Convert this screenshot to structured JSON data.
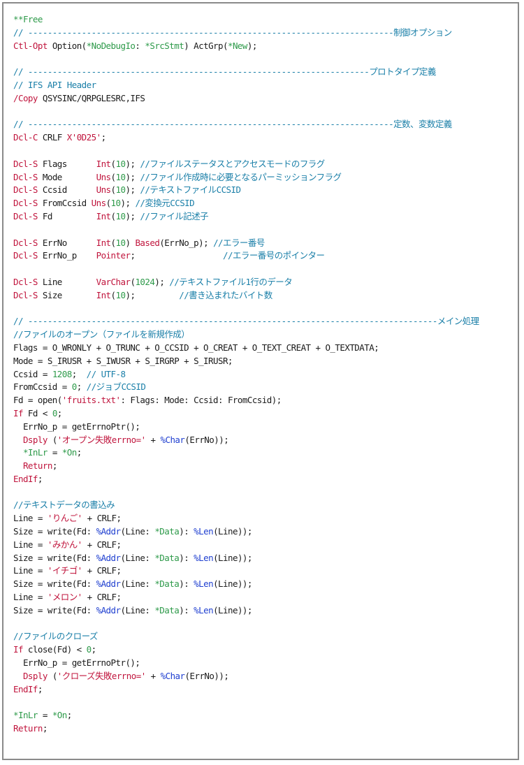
{
  "colors": {
    "plain": "#1a1a1a",
    "comment": "#1a7fa8",
    "keyword": "#c0143c",
    "string": "#c0143c",
    "number": "#2e9a4a",
    "special": "#2e9a4a",
    "builtin": "#1f3fd0",
    "border": "#8a8a8a"
  },
  "lines": [
    [
      [
        "spec",
        "**Free"
      ]
    ],
    [
      [
        "cmt",
        "// ---------------------------------------------------------------------------制御オプション"
      ]
    ],
    [
      [
        "kw",
        "Ctl-Opt"
      ],
      [
        "plain",
        " Option("
      ],
      [
        "spec",
        "*NoDebugIo"
      ],
      [
        "plain",
        ": "
      ],
      [
        "spec",
        "*SrcStmt"
      ],
      [
        "plain",
        ") ActGrp("
      ],
      [
        "spec",
        "*New"
      ],
      [
        "plain",
        ");"
      ]
    ],
    [],
    [
      [
        "cmt",
        "// ----------------------------------------------------------------------プロトタイプ定義"
      ]
    ],
    [
      [
        "cmt",
        "// IFS API Header"
      ]
    ],
    [
      [
        "kw",
        "/Copy"
      ],
      [
        "plain",
        " QSYSINC/QRPGLESRC,IFS"
      ]
    ],
    [],
    [
      [
        "cmt",
        "// ---------------------------------------------------------------------------定数、変数定義"
      ]
    ],
    [
      [
        "kw",
        "Dcl-C"
      ],
      [
        "plain",
        " CRLF "
      ],
      [
        "str",
        "X'0D25'"
      ],
      [
        "plain",
        ";"
      ]
    ],
    [],
    [
      [
        "kw",
        "Dcl-S"
      ],
      [
        "plain",
        " Flags      "
      ],
      [
        "kw",
        "Int"
      ],
      [
        "plain",
        "("
      ],
      [
        "num",
        "10"
      ],
      [
        "plain",
        "); "
      ],
      [
        "cmt",
        "//ファイルステータスとアクセスモードのフラグ"
      ]
    ],
    [
      [
        "kw",
        "Dcl-S"
      ],
      [
        "plain",
        " Mode       "
      ],
      [
        "kw",
        "Uns"
      ],
      [
        "plain",
        "("
      ],
      [
        "num",
        "10"
      ],
      [
        "plain",
        "); "
      ],
      [
        "cmt",
        "//ファイル作成時に必要となるパーミッションフラグ"
      ]
    ],
    [
      [
        "kw",
        "Dcl-S"
      ],
      [
        "plain",
        " Ccsid      "
      ],
      [
        "kw",
        "Uns"
      ],
      [
        "plain",
        "("
      ],
      [
        "num",
        "10"
      ],
      [
        "plain",
        "); "
      ],
      [
        "cmt",
        "//テキストファイルCCSID"
      ]
    ],
    [
      [
        "kw",
        "Dcl-S"
      ],
      [
        "plain",
        " FromCcsid "
      ],
      [
        "kw",
        "Uns"
      ],
      [
        "plain",
        "("
      ],
      [
        "num",
        "10"
      ],
      [
        "plain",
        "); "
      ],
      [
        "cmt",
        "//変換元CCSID"
      ]
    ],
    [
      [
        "kw",
        "Dcl-S"
      ],
      [
        "plain",
        " Fd         "
      ],
      [
        "kw",
        "Int"
      ],
      [
        "plain",
        "("
      ],
      [
        "num",
        "10"
      ],
      [
        "plain",
        "); "
      ],
      [
        "cmt",
        "//ファイル記述子"
      ]
    ],
    [],
    [
      [
        "kw",
        "Dcl-S"
      ],
      [
        "plain",
        " ErrNo      "
      ],
      [
        "kw",
        "Int"
      ],
      [
        "plain",
        "("
      ],
      [
        "num",
        "10"
      ],
      [
        "plain",
        ") "
      ],
      [
        "kw",
        "Based"
      ],
      [
        "plain",
        "(ErrNo_p); "
      ],
      [
        "cmt",
        "//エラー番号"
      ]
    ],
    [
      [
        "kw",
        "Dcl-S"
      ],
      [
        "plain",
        " ErrNo_p    "
      ],
      [
        "kw",
        "Pointer"
      ],
      [
        "plain",
        ";                  "
      ],
      [
        "cmt",
        "//エラー番号のポインター"
      ]
    ],
    [],
    [
      [
        "kw",
        "Dcl-S"
      ],
      [
        "plain",
        " Line       "
      ],
      [
        "kw",
        "VarChar"
      ],
      [
        "plain",
        "("
      ],
      [
        "num",
        "1024"
      ],
      [
        "plain",
        "); "
      ],
      [
        "cmt",
        "//テキストファイル1行のデータ"
      ]
    ],
    [
      [
        "kw",
        "Dcl-S"
      ],
      [
        "plain",
        " Size       "
      ],
      [
        "kw",
        "Int"
      ],
      [
        "plain",
        "("
      ],
      [
        "num",
        "10"
      ],
      [
        "plain",
        ");         "
      ],
      [
        "cmt",
        "//書き込まれたバイト数"
      ]
    ],
    [],
    [
      [
        "cmt",
        "// ------------------------------------------------------------------------------------メイン処理"
      ]
    ],
    [
      [
        "cmt",
        "//ファイルのオープン（ファイルを新規作成）"
      ]
    ],
    [
      [
        "plain",
        "Flags = O_WRONLY + O_TRUNC + O_CCSID + O_CREAT + O_TEXT_CREAT + O_TEXTDATA;"
      ]
    ],
    [
      [
        "plain",
        "Mode = S_IRUSR + S_IWUSR + S_IRGRP + S_IRUSR;"
      ]
    ],
    [
      [
        "plain",
        "Ccsid = "
      ],
      [
        "num",
        "1208"
      ],
      [
        "plain",
        ";  "
      ],
      [
        "cmt",
        "// UTF-8"
      ]
    ],
    [
      [
        "plain",
        "FromCcsid = "
      ],
      [
        "num",
        "0"
      ],
      [
        "plain",
        "; "
      ],
      [
        "cmt",
        "//ジョブCCSID"
      ]
    ],
    [
      [
        "plain",
        "Fd = open("
      ],
      [
        "str",
        "'fruits.txt'"
      ],
      [
        "plain",
        ": Flags: Mode: Ccsid: FromCcsid);"
      ]
    ],
    [
      [
        "kw",
        "If"
      ],
      [
        "plain",
        " Fd < "
      ],
      [
        "num",
        "0"
      ],
      [
        "plain",
        ";"
      ]
    ],
    [
      [
        "plain",
        "  ErrNo_p = getErrnoPtr();"
      ]
    ],
    [
      [
        "plain",
        "  "
      ],
      [
        "kw",
        "Dsply"
      ],
      [
        "plain",
        " ("
      ],
      [
        "str",
        "'オープン失敗errno='"
      ],
      [
        "plain",
        " + "
      ],
      [
        "bif",
        "%Char"
      ],
      [
        "plain",
        "(ErrNo));"
      ]
    ],
    [
      [
        "plain",
        "  "
      ],
      [
        "spec",
        "*InLr"
      ],
      [
        "plain",
        " = "
      ],
      [
        "spec",
        "*On"
      ],
      [
        "plain",
        ";"
      ]
    ],
    [
      [
        "plain",
        "  "
      ],
      [
        "kw",
        "Return"
      ],
      [
        "plain",
        ";"
      ]
    ],
    [
      [
        "kw",
        "EndIf"
      ],
      [
        "plain",
        ";"
      ]
    ],
    [],
    [
      [
        "cmt",
        "//テキストデータの書込み"
      ]
    ],
    [
      [
        "plain",
        "Line = "
      ],
      [
        "str",
        "'りんご'"
      ],
      [
        "plain",
        " + CRLF;"
      ]
    ],
    [
      [
        "plain",
        "Size = write(Fd: "
      ],
      [
        "bif",
        "%Addr"
      ],
      [
        "plain",
        "(Line: "
      ],
      [
        "spec",
        "*Data"
      ],
      [
        "plain",
        "): "
      ],
      [
        "bif",
        "%Len"
      ],
      [
        "plain",
        "(Line));"
      ]
    ],
    [
      [
        "plain",
        "Line = "
      ],
      [
        "str",
        "'みかん'"
      ],
      [
        "plain",
        " + CRLF;"
      ]
    ],
    [
      [
        "plain",
        "Size = write(Fd: "
      ],
      [
        "bif",
        "%Addr"
      ],
      [
        "plain",
        "(Line: "
      ],
      [
        "spec",
        "*Data"
      ],
      [
        "plain",
        "): "
      ],
      [
        "bif",
        "%Len"
      ],
      [
        "plain",
        "(Line));"
      ]
    ],
    [
      [
        "plain",
        "Line = "
      ],
      [
        "str",
        "'イチゴ'"
      ],
      [
        "plain",
        " + CRLF;"
      ]
    ],
    [
      [
        "plain",
        "Size = write(Fd: "
      ],
      [
        "bif",
        "%Addr"
      ],
      [
        "plain",
        "(Line: "
      ],
      [
        "spec",
        "*Data"
      ],
      [
        "plain",
        "): "
      ],
      [
        "bif",
        "%Len"
      ],
      [
        "plain",
        "(Line));"
      ]
    ],
    [
      [
        "plain",
        "Line = "
      ],
      [
        "str",
        "'メロン'"
      ],
      [
        "plain",
        " + CRLF;"
      ]
    ],
    [
      [
        "plain",
        "Size = write(Fd: "
      ],
      [
        "bif",
        "%Addr"
      ],
      [
        "plain",
        "(Line: "
      ],
      [
        "spec",
        "*Data"
      ],
      [
        "plain",
        "): "
      ],
      [
        "bif",
        "%Len"
      ],
      [
        "plain",
        "(Line));"
      ]
    ],
    [],
    [
      [
        "cmt",
        "//ファイルのクローズ"
      ]
    ],
    [
      [
        "kw",
        "If"
      ],
      [
        "plain",
        " close(Fd) < "
      ],
      [
        "num",
        "0"
      ],
      [
        "plain",
        ";"
      ]
    ],
    [
      [
        "plain",
        "  ErrNo_p = getErrnoPtr();"
      ]
    ],
    [
      [
        "plain",
        "  "
      ],
      [
        "kw",
        "Dsply"
      ],
      [
        "plain",
        " ("
      ],
      [
        "str",
        "'クローズ失敗errno='"
      ],
      [
        "plain",
        " + "
      ],
      [
        "bif",
        "%Char"
      ],
      [
        "plain",
        "(ErrNo));"
      ]
    ],
    [
      [
        "kw",
        "EndIf"
      ],
      [
        "plain",
        ";"
      ]
    ],
    [],
    [
      [
        "spec",
        "*InLr"
      ],
      [
        "plain",
        " = "
      ],
      [
        "spec",
        "*On"
      ],
      [
        "plain",
        ";"
      ]
    ],
    [
      [
        "kw",
        "Return"
      ],
      [
        "plain",
        ";"
      ]
    ]
  ]
}
